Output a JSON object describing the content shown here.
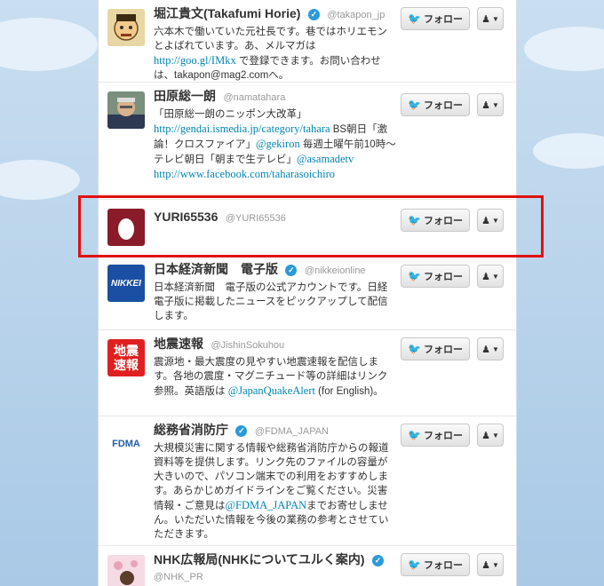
{
  "users": [
    {
      "name": "堀江貴文(Takafumi Horie)",
      "handle": "@takapon_jp",
      "verified": true,
      "bio": [
        {
          "t": "六本木で働いていた元社長です。巷ではホリエモンとよばれています。あ、メルマガは "
        },
        {
          "t": "http://goo.gl/IMkx",
          "link": true
        },
        {
          "t": " で登録できます。お問い合わせは、takapon@mag2.comへ。"
        }
      ],
      "avatar": "horie",
      "follow_label": "フォロー"
    },
    {
      "name": "田原総一朗",
      "handle": "@namatahara",
      "verified": false,
      "bio": [
        {
          "t": "「田原総一朗のニッポン大改革」"
        },
        {
          "t": "http://gendai.ismedia.jp/category/tahara",
          "link": true
        },
        {
          "t": " BS朝日「激論！クロスファイア」"
        },
        {
          "t": "@gekiron",
          "link": true
        },
        {
          "t": " 毎週土曜午前10時～　テレビ朝日「朝まで生テレビ」"
        },
        {
          "t": "@asamadetv",
          "link": true
        },
        {
          "t": " "
        },
        {
          "t": "http://www.facebook.com/taharasoichiro",
          "link": true
        }
      ],
      "avatar": "tahara",
      "follow_label": "フォロー"
    },
    {
      "name": "YURI65536",
      "handle": "@YURI65536",
      "verified": false,
      "bio": [],
      "avatar": "egg",
      "follow_label": "フォロー"
    },
    {
      "name": "日本経済新聞　電子版",
      "handle": "@nikkeionline",
      "verified": true,
      "bio": [
        {
          "t": "日本経済新聞　電子版の公式アカウントです。日経電子版に掲載したニュースをピックアップして配信します。"
        }
      ],
      "avatar": "nikkei",
      "avatar_text": "NIKKEI",
      "follow_label": "フォロー"
    },
    {
      "name": "地震速報",
      "handle": "@JishinSokuhou",
      "verified": false,
      "bio": [
        {
          "t": "震源地・最大震度の見やすい地震速報を配信します。各地の震度・マグニチュード等の詳細はリンク参照。英語版は "
        },
        {
          "t": "@JapanQuakeAlert",
          "link": true
        },
        {
          "t": " (for English)。"
        }
      ],
      "avatar": "jishin",
      "avatar_text": "地震速報",
      "follow_label": "フォロー"
    },
    {
      "name": "総務省消防庁",
      "handle": "@FDMA_JAPAN",
      "verified": true,
      "bio": [
        {
          "t": "大規模災害に関する情報や総務省消防庁からの報道資料等を提供します。リンク先のファイルの容量が大きいので、パソコン端末での利用をおすすめします。あらかじめガイドラインをご覧ください。災害情報・ご意見は"
        },
        {
          "t": "@FDMA_JAPAN",
          "link": true
        },
        {
          "t": "までお寄せしません。いただいた情報を今後の業務の参考とさせていただきます。"
        }
      ],
      "avatar": "fdma",
      "avatar_text": "FDMA",
      "follow_label": "フォロー"
    },
    {
      "name": "NHK広報局(NHKについてユルく案内)",
      "handle": "@NHK_PR",
      "verified": true,
      "bio": [],
      "avatar": "nhk",
      "follow_label": "フォロー"
    }
  ]
}
